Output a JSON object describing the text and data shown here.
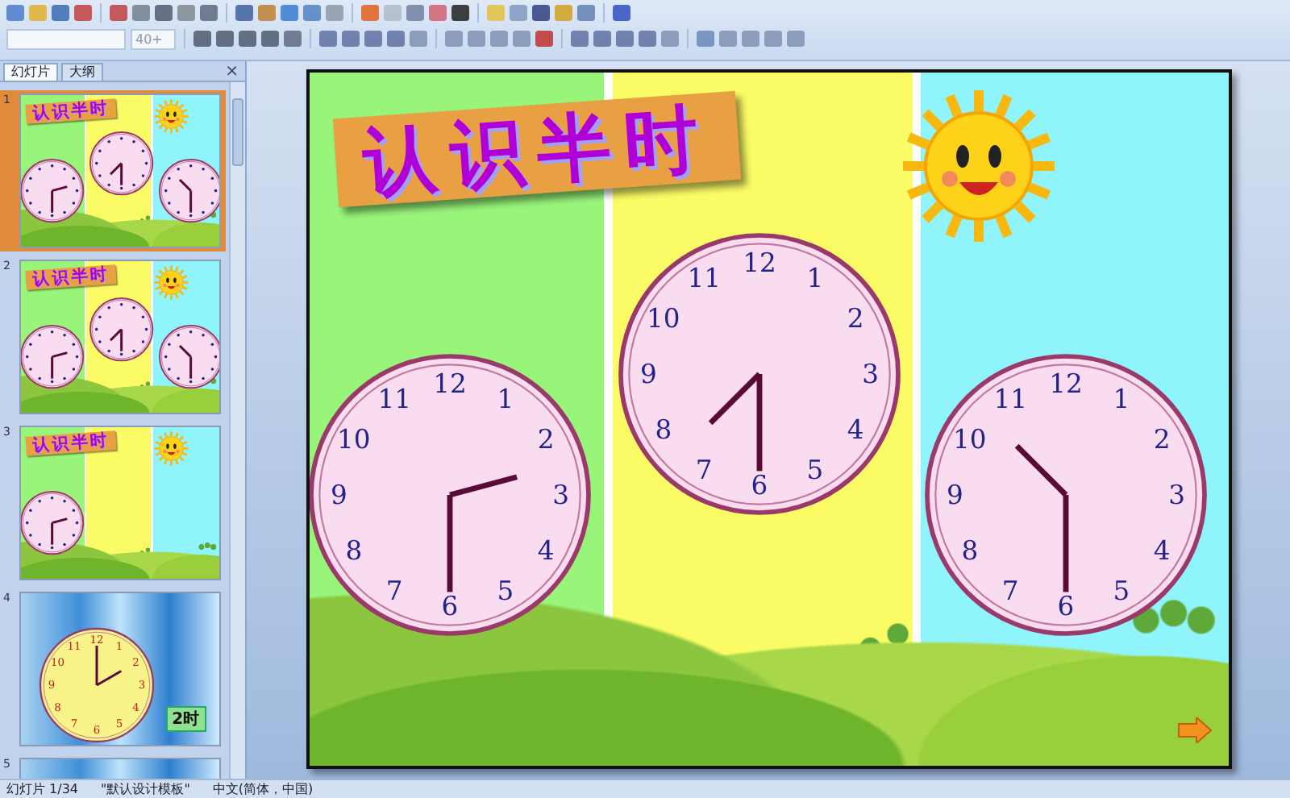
{
  "toolbar": {
    "font_size": "40+"
  },
  "pane": {
    "tabs": [
      {
        "label": "幻灯片",
        "selected": true
      },
      {
        "label": "大纲",
        "selected": false
      }
    ],
    "close": "×"
  },
  "thumbnails": [
    {
      "number": "1",
      "kind": "clocks",
      "selected": true,
      "title": "认识半时",
      "clocks": [
        {
          "kind": "dots"
        },
        {
          "kind": "dots"
        },
        {
          "kind": "dots"
        }
      ]
    },
    {
      "number": "2",
      "kind": "clocks",
      "selected": false,
      "title": "认识半时",
      "clocks": [
        {
          "kind": "dots"
        },
        {
          "kind": "dots"
        },
        {
          "kind": "dots"
        }
      ]
    },
    {
      "number": "3",
      "kind": "clocks",
      "selected": false,
      "title": "认识半时",
      "clocks": [
        {
          "kind": "dots"
        }
      ]
    },
    {
      "number": "4",
      "kind": "clock-face",
      "selected": false,
      "label": "2时",
      "numbers": [
        "12",
        "1",
        "2",
        "3",
        "4",
        "5",
        "6",
        "7",
        "8",
        "9",
        "10",
        "11"
      ]
    },
    {
      "number": "5",
      "kind": "clock-face",
      "selected": false
    }
  ],
  "slide": {
    "title": "认识半时",
    "clocks": [
      {
        "numbers": [
          "12",
          "1",
          "2",
          "3",
          "4",
          "5",
          "6",
          "7",
          "8",
          "9",
          "10",
          "11"
        ]
      },
      {
        "numbers": [
          "12",
          "1",
          "2",
          "3",
          "4",
          "5",
          "6",
          "7",
          "8",
          "9",
          "10",
          "11"
        ]
      },
      {
        "numbers": [
          "12",
          "1",
          "2",
          "3",
          "4",
          "5",
          "6",
          "7",
          "8",
          "9",
          "10",
          "11"
        ]
      }
    ]
  },
  "status_bar": {
    "slide": "幻灯片 1/34",
    "template": "\"默认设计模板\"",
    "language": "中文(简体，中国)"
  }
}
